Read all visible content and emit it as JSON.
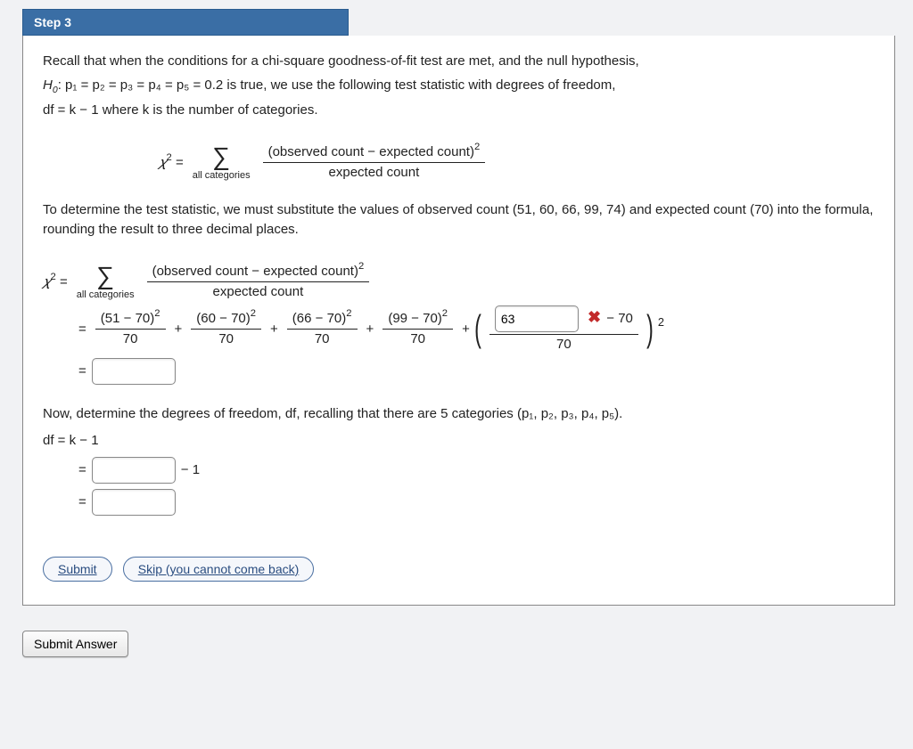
{
  "step": {
    "label": "Step 3"
  },
  "intro": {
    "line1": "Recall that when the conditions for a chi-square goodness-of-fit test are met, and the null hypothesis,",
    "h0_prefix": "H",
    "h0_sub": "0",
    "p_eq_text": ": p₁ = p₂ = p₃ = p₄ = p₅ = 0.2 is true, we use the following test statistic with degrees of freedom,",
    "line3": "df = k − 1 where k is the number of categories."
  },
  "formula_def": {
    "lhs": "𝜒",
    "exp": "2",
    "eq": " = ",
    "sigma_sub": "all categories",
    "frac_num": "(observed count − expected count)",
    "frac_num_exp": "2",
    "frac_den": "expected count"
  },
  "mid_text": "To determine the test statistic, we must substitute the values of observed count (51, 60, 66, 99, 74) and expected count (70) into the formula, rounding the result to three decimal places.",
  "calc": {
    "terms": [
      {
        "obs": "51",
        "exp": "70",
        "den": "70"
      },
      {
        "obs": "60",
        "exp": "70",
        "den": "70"
      },
      {
        "obs": "66",
        "exp": "70",
        "den": "70"
      },
      {
        "obs": "99",
        "exp": "70",
        "den": "70"
      }
    ],
    "last_input_value": "63",
    "last_minus_val": "70",
    "last_den": "70",
    "plus": " + ",
    "minus": " − "
  },
  "df_text": {
    "line": "Now, determine the degrees of freedom, df, recalling that there are 5 categories (p₁, p₂, p₃, p₄, p₅).",
    "eq1": "df  =  k − 1",
    "minus1": " − 1"
  },
  "buttons": {
    "submit": "Submit",
    "skip": "Skip (you cannot come back)",
    "submit_answer": "Submit Answer"
  },
  "icons": {
    "wrong_x": "✖"
  }
}
